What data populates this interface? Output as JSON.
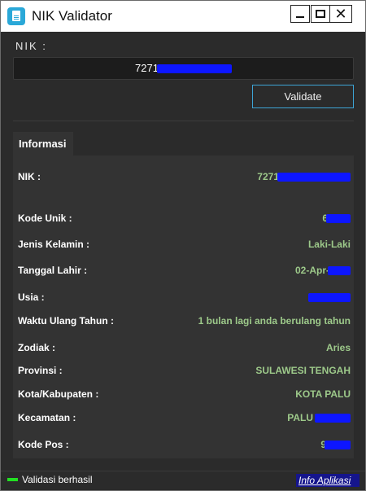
{
  "window": {
    "title": "NIK Validator",
    "app_icon": "document-icon",
    "minimize_icon": "minimize-icon",
    "maximize_icon": "maximize-icon",
    "close_glyph": "✕"
  },
  "form": {
    "nik_label": "NIK :",
    "nik_value_visible": "7271",
    "validate_label": "Validate"
  },
  "panel": {
    "tab_label": "Informasi",
    "rows": [
      {
        "label": "NIK :",
        "value": "7271"
      },
      {
        "label": "Kode Unik :",
        "value": "6"
      },
      {
        "label": "Jenis Kelamin :",
        "value": "Laki-Laki"
      },
      {
        "label": "Tanggal Lahir :",
        "value": "02-Apr-"
      },
      {
        "label": "Usia :",
        "value": ""
      },
      {
        "label": "Waktu Ulang Tahun :",
        "value": "1 bulan lagi anda berulang tahun"
      },
      {
        "label": "Zodiak :",
        "value": "Aries"
      },
      {
        "label": "Provinsi :",
        "value": "SULAWESI TENGAH"
      },
      {
        "label": "Kota/Kabupaten :",
        "value": "KOTA PALU"
      },
      {
        "label": "Kecamatan :",
        "value": "PALU"
      },
      {
        "label": "Kode Pos :",
        "value": "9"
      }
    ]
  },
  "status": {
    "text": "Validasi berhasil",
    "info_link": "Info Aplikasi"
  },
  "colors": {
    "value_green": "#9dc98a",
    "accent_blue": "#3da5d6",
    "redaction": "#0d16ff",
    "status_led": "#22e022"
  }
}
